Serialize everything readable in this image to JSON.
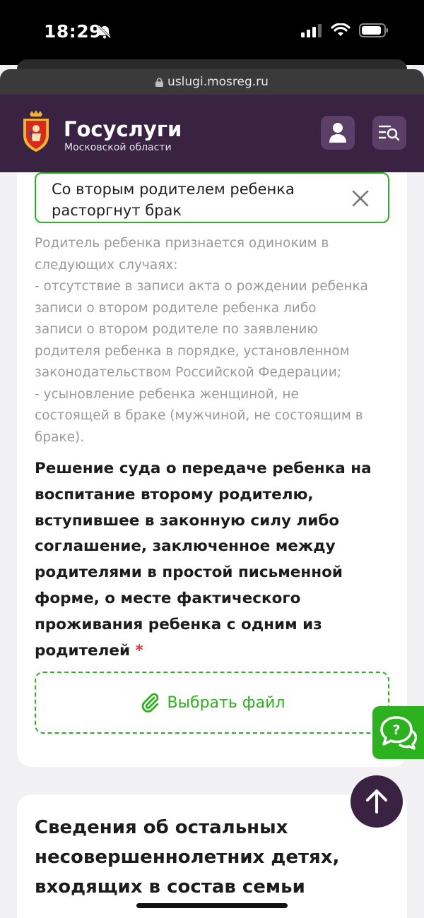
{
  "status_bar": {
    "time": "18:29"
  },
  "browser": {
    "url": "uslugi.mosreg.ru"
  },
  "header": {
    "title": "Госуслуги",
    "subtitle": "Московской области"
  },
  "form": {
    "selected_option": "Со вторым родителем ребенка расторгнут брак",
    "help_lines": [
      "Родитель ребенка признается одиноким в",
      "следующих случаях:",
      "- отсутствие в записи акта о рождении ребенка",
      "записи о втором родителе ребенка либо",
      "записи о втором родителе по заявлению",
      "родителя ребенка в порядке, установленном",
      "законодательством Российской Федерации;",
      "- усыновление ребенка женщиной, не",
      "состоящей в браке (мужчиной, не состоящим в",
      "браке)."
    ],
    "field_label_lines": [
      "Решение суда о передаче ребенка на",
      "воспитание второму родителю,",
      "вступившее в законную силу либо",
      "соглашение, заключенное между",
      "родителями в простой письменной",
      "форме, о месте фактического",
      "проживания ребенка с одним из",
      "родителей"
    ],
    "required_mark": "*",
    "upload_label": "Выбрать файл"
  },
  "next_section": {
    "title_lines": [
      "Сведения об остальных",
      "несовершеннолетних детях,",
      "входящих в состав семьи"
    ]
  },
  "colors": {
    "brand_purple": "#3a2342",
    "accent_green": "#2bb21e",
    "required_red": "#e03a3a"
  },
  "icons": {
    "attach": "paperclip-icon",
    "chat": "chat-bubbles-icon",
    "scroll_top": "arrow-up-icon",
    "user": "user-icon",
    "menu": "search-list-icon",
    "clear": "close-icon"
  }
}
